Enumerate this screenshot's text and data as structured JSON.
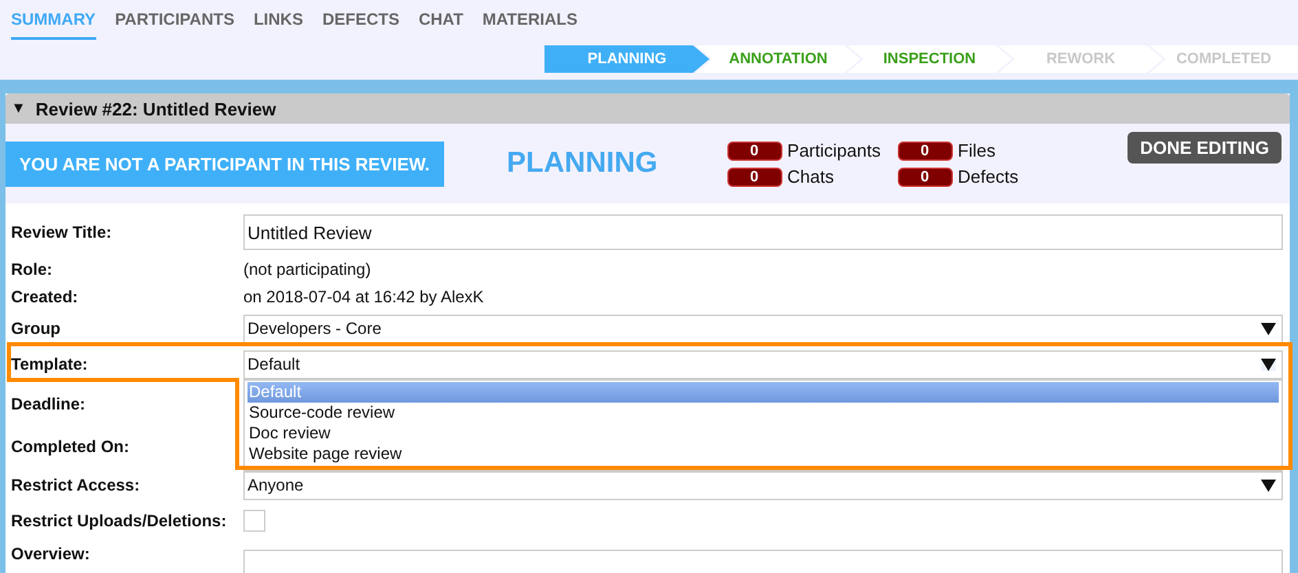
{
  "tabs": [
    {
      "label": "SUMMARY",
      "selected": true
    },
    {
      "label": "PARTICIPANTS",
      "selected": false
    },
    {
      "label": "LINKS",
      "selected": false
    },
    {
      "label": "DEFECTS",
      "selected": false
    },
    {
      "label": "CHAT",
      "selected": false
    },
    {
      "label": "MATERIALS",
      "selected": false
    }
  ],
  "workflow": [
    {
      "label": "PLANNING",
      "selected": true,
      "disabled": false
    },
    {
      "label": "ANNOTATION",
      "selected": false,
      "disabled": false
    },
    {
      "label": "INSPECTION",
      "selected": false,
      "disabled": false
    },
    {
      "label": "REWORK",
      "selected": false,
      "disabled": true
    },
    {
      "label": "COMPLETED",
      "selected": false,
      "disabled": true
    }
  ],
  "panel": {
    "title": "Review #22: Untitled Review",
    "expanded": true,
    "expander": "▼"
  },
  "notice": "YOU ARE NOT A PARTICIPANT IN THIS REVIEW.",
  "phase": "PLANNING",
  "counters": [
    {
      "count": "0",
      "label": "Participants"
    },
    {
      "count": "0",
      "label": "Files"
    },
    {
      "count": "0",
      "label": "Chats"
    },
    {
      "count": "0",
      "label": "Defects"
    }
  ],
  "done_button": "DONE EDITING",
  "fields": [
    {
      "kind": "input",
      "label": "Review Title:",
      "value": "Untitled Review"
    },
    {
      "kind": "text",
      "label": "Role:",
      "value": "(not participating)"
    },
    {
      "kind": "text",
      "label": "Created:",
      "value": "on 2018-07-04 at 16:42 by AlexK"
    },
    {
      "kind": "select",
      "label": "Group",
      "value": "Developers - Core",
      "expanded": false
    },
    {
      "kind": "select",
      "label": "Template:",
      "value": "Default",
      "expanded": true,
      "highlighted": true,
      "options": [
        {
          "label": "Default",
          "selected": true
        },
        {
          "label": "Source-code review",
          "selected": false
        },
        {
          "label": "Doc review",
          "selected": false
        },
        {
          "label": "Website page review",
          "selected": false
        }
      ]
    },
    {
      "kind": "hidden",
      "label": "Deadline:"
    },
    {
      "kind": "hidden",
      "label": "Completed On:"
    },
    {
      "kind": "select",
      "label": "Restrict Access:",
      "value": "Anyone",
      "expanded": false
    },
    {
      "kind": "checkbox",
      "label": "Restrict Uploads/Deletions:",
      "checked": false
    },
    {
      "kind": "textarea",
      "label": "Overview:"
    }
  ]
}
